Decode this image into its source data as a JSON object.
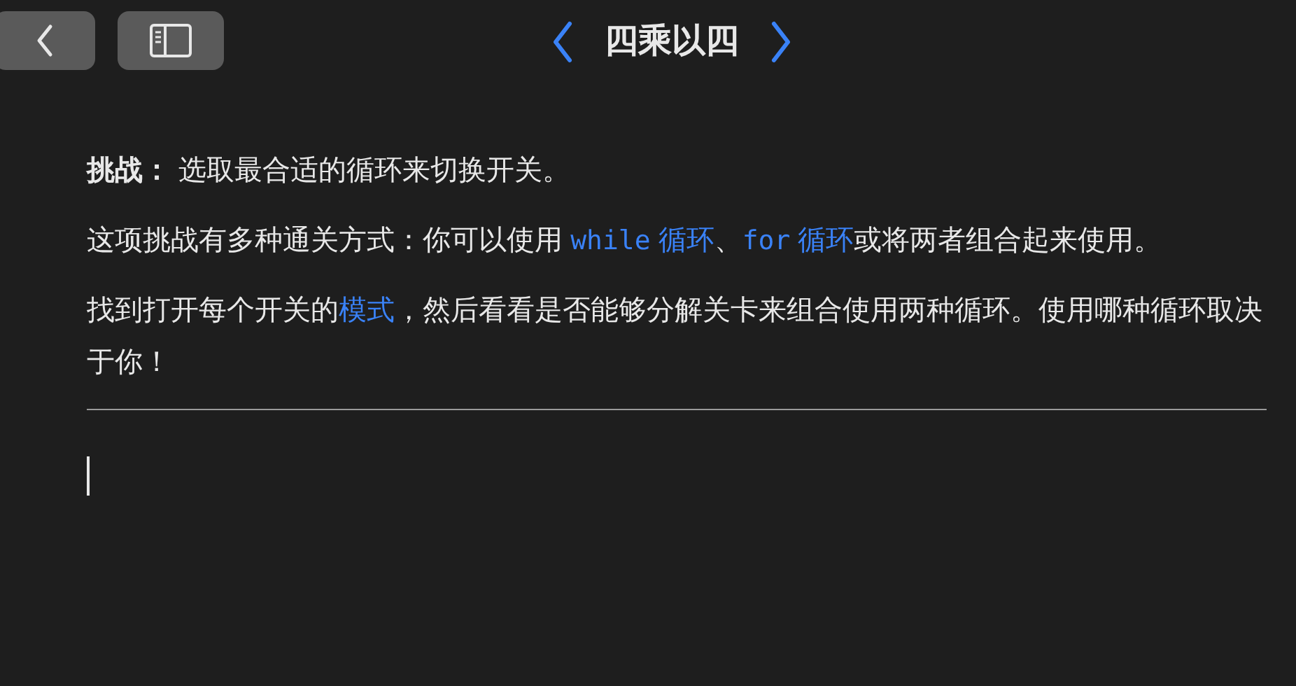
{
  "toolbar": {
    "title": "四乘以四"
  },
  "paragraphs": [
    {
      "segments": [
        {
          "kind": "text",
          "text": "**挑战：** 选取最合适的循环来切换开关。"
        }
      ]
    },
    {
      "segments": [
        {
          "kind": "text",
          "text": "这项挑战有多种通关方式：你可以使用 "
        },
        {
          "kind": "link",
          "parts": [
            {
              "kind": "code",
              "text": "while"
            },
            {
              "kind": "text",
              "text": " 循环"
            }
          ]
        },
        {
          "kind": "text",
          "text": "、"
        },
        {
          "kind": "link",
          "parts": [
            {
              "kind": "code",
              "text": "for"
            },
            {
              "kind": "text",
              "text": " 循环"
            }
          ]
        },
        {
          "kind": "text",
          "text": "或将两者组合起来使用。"
        }
      ]
    },
    {
      "segments": [
        {
          "kind": "text",
          "text": "找到打开每个开关的"
        },
        {
          "kind": "link",
          "parts": [
            {
              "kind": "text",
              "text": "模式"
            }
          ]
        },
        {
          "kind": "text",
          "text": "，然后看看是否能够分解关卡来组合使用两种循环。使用哪种循环取决于你！"
        }
      ]
    }
  ]
}
